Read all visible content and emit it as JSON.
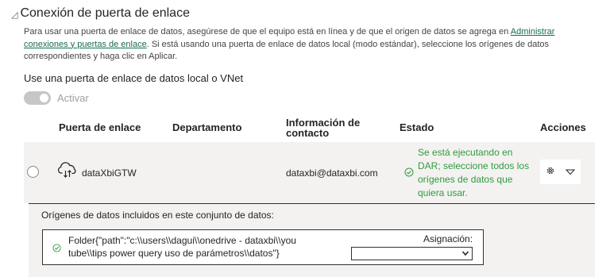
{
  "section": {
    "title": "Conexión de puerta de enlace",
    "description_text": "Para usar una puerta de enlace de datos, asegúrese de que el equipo está en línea y de que el origen de datos se agrega en ",
    "description_link": "Administrar conexiones y puertas de enlace",
    "description_rest": ". Si está usando una puerta de enlace de datos local (modo estándar), seleccione los orígenes de datos correspondientes y haga clic en Aplicar."
  },
  "vnet": {
    "heading": "Use una puerta de enlace de datos local o VNet",
    "toggle_label": "Activar",
    "toggle_on": false
  },
  "table": {
    "headers": {
      "gateway": "Puerta de enlace",
      "department": "Departamento",
      "contact": "Información de contacto",
      "status": "Estado",
      "actions": "Acciones"
    },
    "row": {
      "gateway_name": "dataXbiGTW",
      "department": "",
      "contact": "dataxbi@dataxbi.com",
      "status": "Se está ejecutando en DAR; seleccione todos los orígenes de datos que quiera usar.",
      "status_color": "#2f9b3f",
      "icons": [
        "cloud-gateway-icon",
        "check-circle-icon",
        "gear-icon",
        "chevron-down-icon"
      ]
    }
  },
  "datasources": {
    "title": "Orígenes de datos incluidos en este conjunto de datos:",
    "item": "Folder{\"path\":\"c:\\\\users\\\\dagui\\\\onedrive - dataxbi\\\\you tube\\\\tips power query uso de parámetros\\\\datos\"}",
    "assign_label": "Asignación:",
    "assign_value": ""
  }
}
